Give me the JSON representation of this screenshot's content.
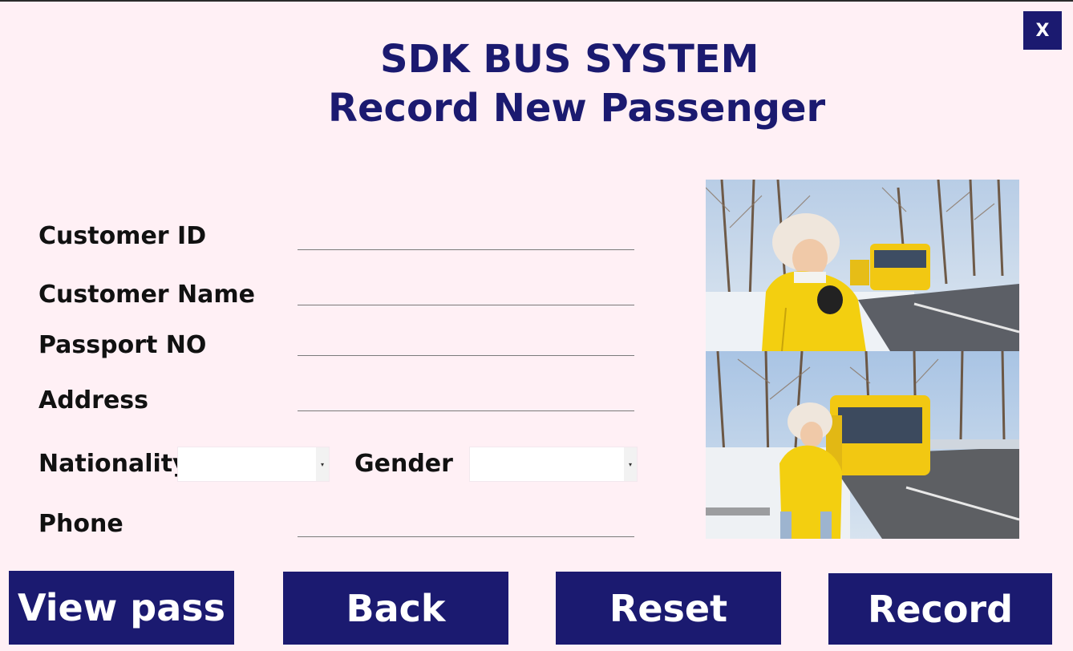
{
  "window": {
    "close_label": "X"
  },
  "header": {
    "title": "SDK BUS SYSTEM",
    "subtitle": "Record New Passenger"
  },
  "form": {
    "customer_id_label": "Customer ID",
    "customer_id_value": "",
    "customer_name_label": "Customer Name",
    "customer_name_value": "",
    "passport_label": "Passport NO",
    "passport_value": "",
    "address_label": "Address",
    "address_value": "",
    "nationality_label": "Nationality",
    "nationality_value": "",
    "gender_label": "Gender",
    "gender_value": "",
    "phone_label": "Phone",
    "phone_value": ""
  },
  "images": {
    "top": "woman-in-yellow-jacket-with-bus",
    "bottom": "woman-at-bus-stop-with-yellow-bus"
  },
  "colors": {
    "brand": "#1b1a70",
    "background": "#fff0f5",
    "button_text": "#ffffff"
  },
  "actions": {
    "view_pass": "View pass",
    "back": "Back",
    "reset": "Reset",
    "record": "Record"
  }
}
